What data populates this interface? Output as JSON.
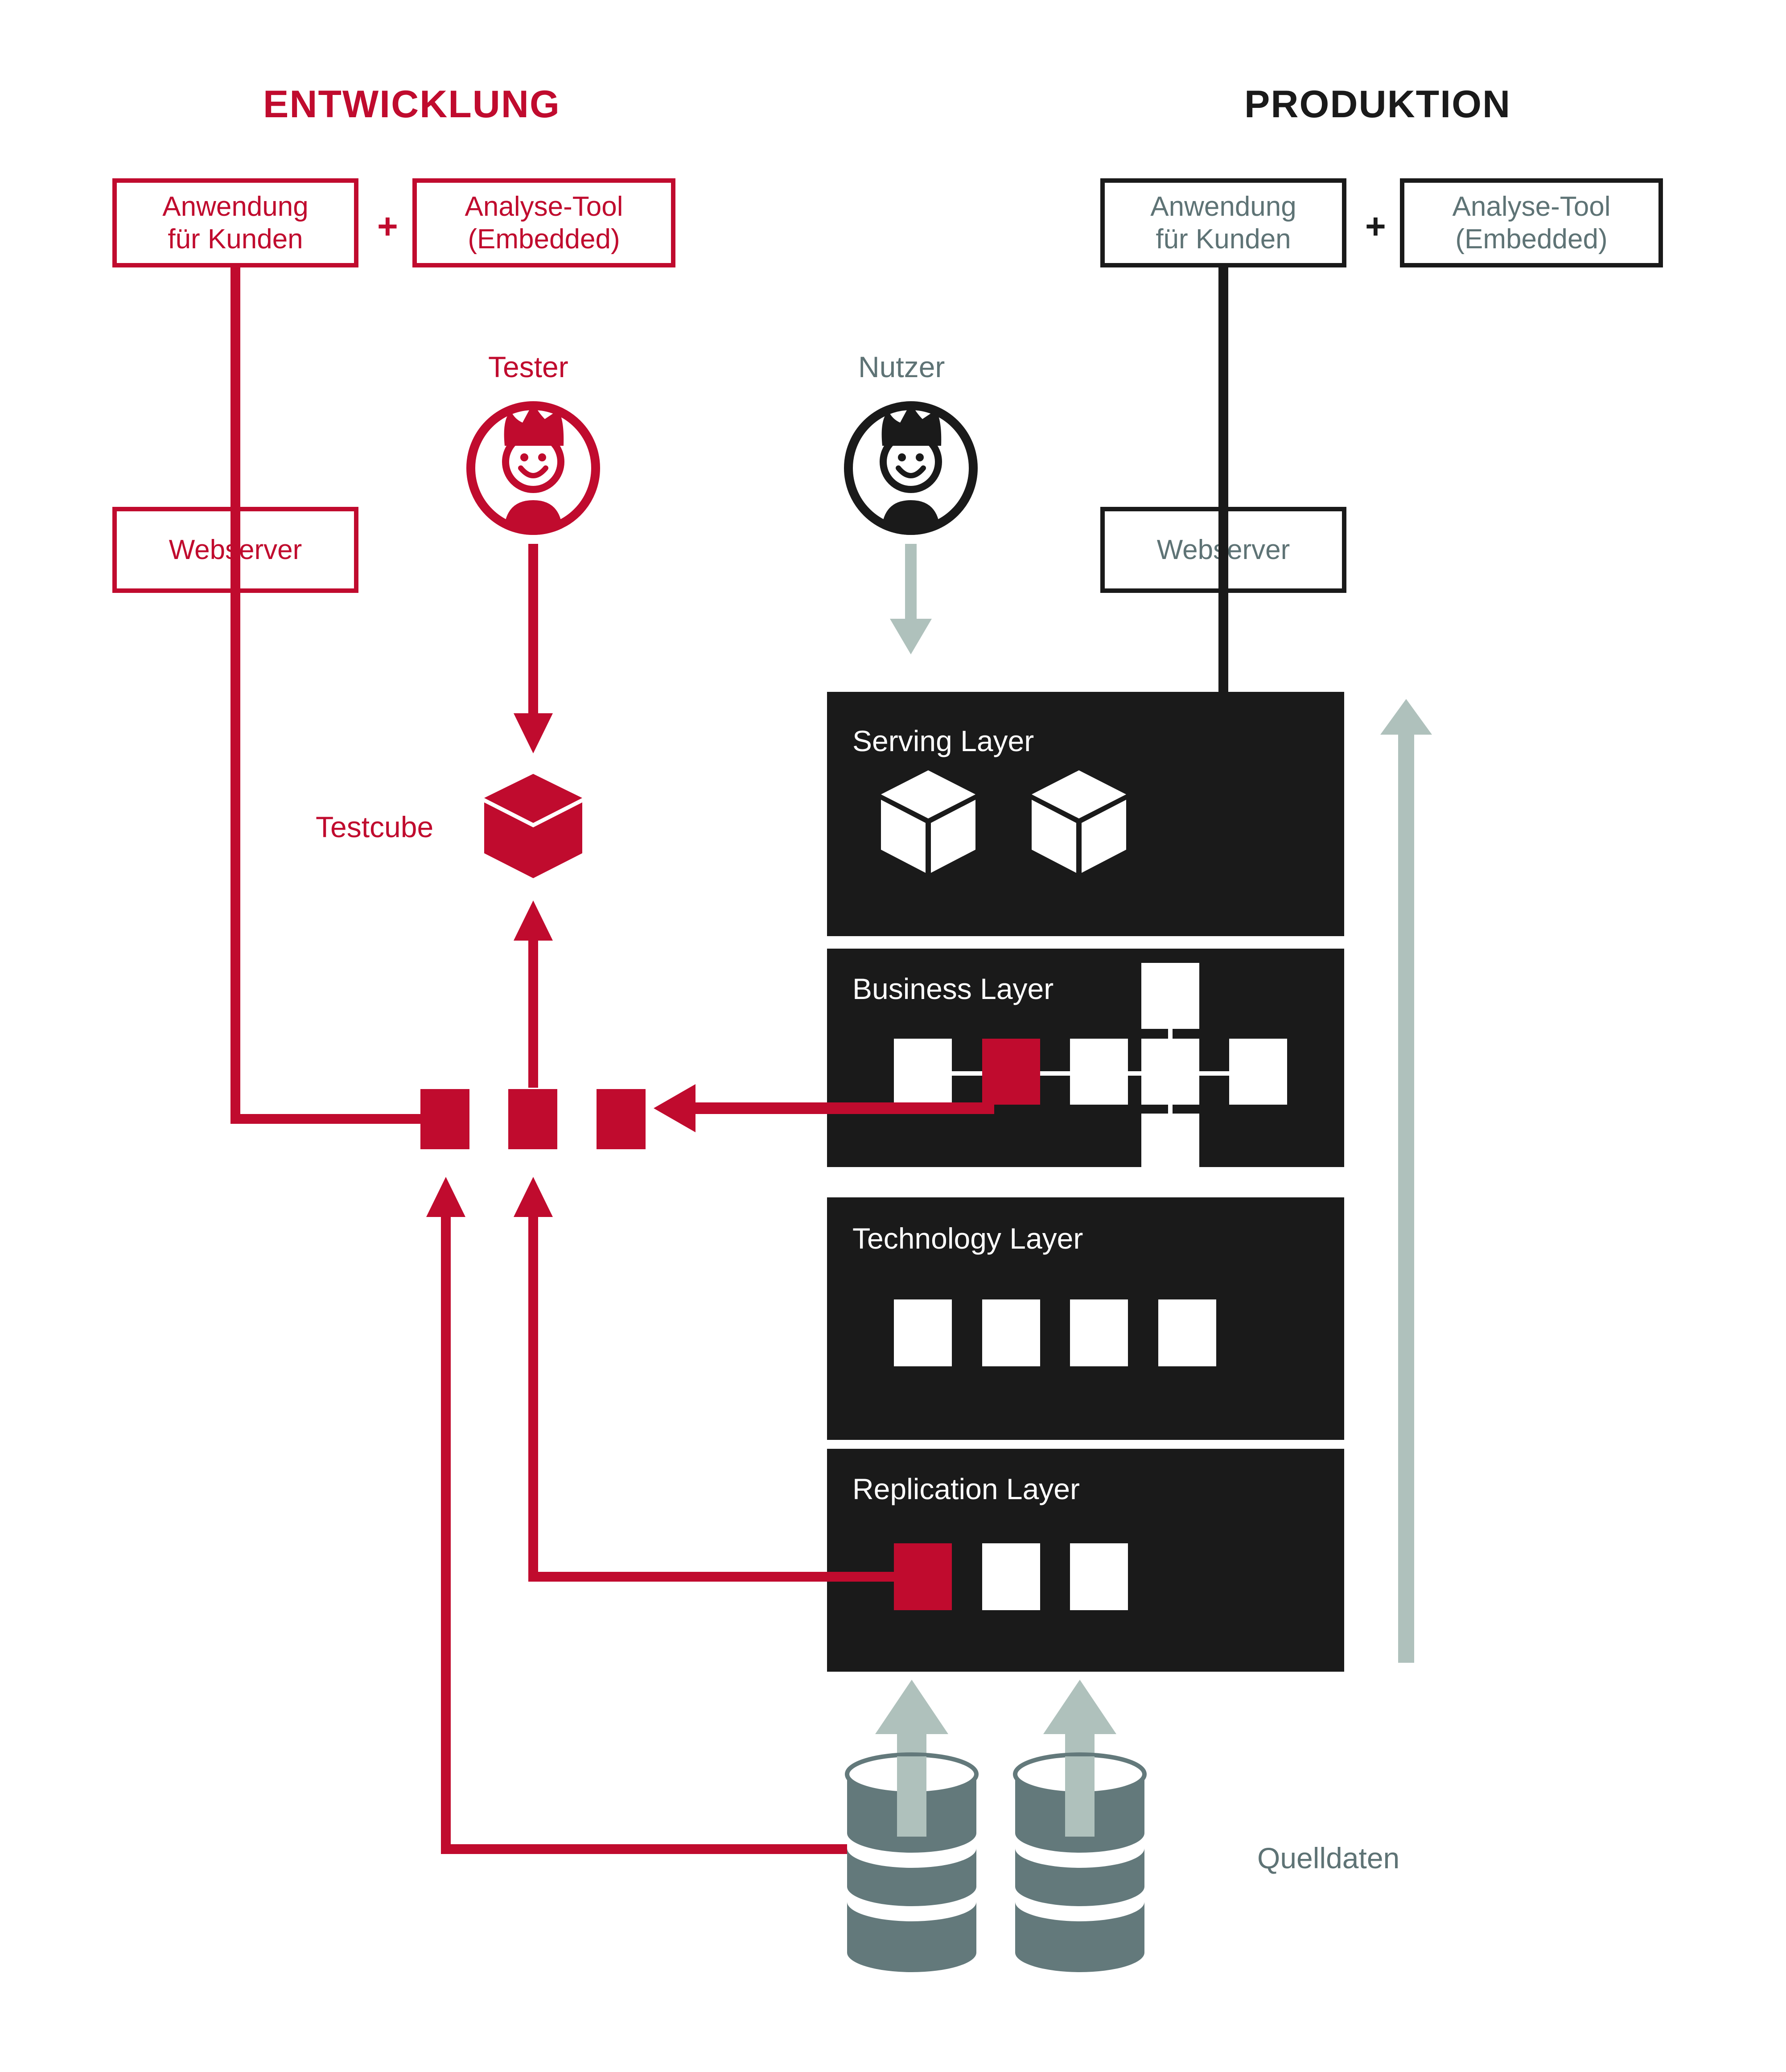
{
  "diagram": {
    "title_left": "ENTWICKLUNG",
    "title_right": "PRODUKTION",
    "colors": {
      "accent_red": "#C00B2E",
      "dark": "#1A1A1A",
      "teal_text": "#5E7375",
      "sage_arrow": "#AFC1BC",
      "cylinder": "#63797B",
      "white": "#FFFFFF"
    }
  },
  "development": {
    "app_box": "Anwendung\nfür Kunden",
    "plus": "+",
    "tool_box": "Analyse-Tool\n(Embedded)",
    "webserver": "Webserver",
    "tester_label": "Tester",
    "tester_icon": "person-avatar-icon",
    "testcube_label": "Testcube",
    "testcube_icon": "cube-icon",
    "dev_blocks": [
      "block-1",
      "block-2",
      "block-3"
    ]
  },
  "production": {
    "app_box": "Anwendung\nfür Kunden",
    "plus": "+",
    "tool_box": "Analyse-Tool\n(Embedded)",
    "webserver": "Webserver",
    "user_label": "Nutzer",
    "user_icon": "person-avatar-icon"
  },
  "stack": {
    "layers": [
      {
        "title": "Serving Layer",
        "id": "serving-layer",
        "nodes": [
          {
            "type": "cube",
            "color": "#FFFFFF"
          },
          {
            "type": "cube",
            "color": "#FFFFFF"
          }
        ]
      },
      {
        "title": "Business Layer",
        "id": "business-layer",
        "nodes": [
          {
            "type": "box",
            "color": "#FFFFFF",
            "pos": "row-1"
          },
          {
            "type": "box",
            "color": "#C00B2E",
            "pos": "row-2"
          },
          {
            "type": "box",
            "color": "#FFFFFF",
            "pos": "row-3"
          },
          {
            "type": "box",
            "color": "#FFFFFF",
            "pos": "row-4"
          },
          {
            "type": "box",
            "color": "#FFFFFF",
            "pos": "row-5"
          },
          {
            "type": "box",
            "color": "#FFFFFF",
            "pos": "above-4"
          },
          {
            "type": "box",
            "color": "#FFFFFF",
            "pos": "below-4"
          }
        ]
      },
      {
        "title": "Technology Layer",
        "id": "technology-layer",
        "nodes": [
          {
            "type": "box",
            "color": "#FFFFFF"
          },
          {
            "type": "box",
            "color": "#FFFFFF"
          },
          {
            "type": "box",
            "color": "#FFFFFF"
          },
          {
            "type": "box",
            "color": "#FFFFFF"
          }
        ]
      },
      {
        "title": "Replication Layer",
        "id": "replication-layer",
        "nodes": [
          {
            "type": "box",
            "color": "#C00B2E"
          },
          {
            "type": "box",
            "color": "#FFFFFF"
          },
          {
            "type": "box",
            "color": "#FFFFFF"
          }
        ]
      }
    ]
  },
  "sources": {
    "label": "Quelldaten",
    "count": 2,
    "icon": "database-cylinder-icon"
  }
}
